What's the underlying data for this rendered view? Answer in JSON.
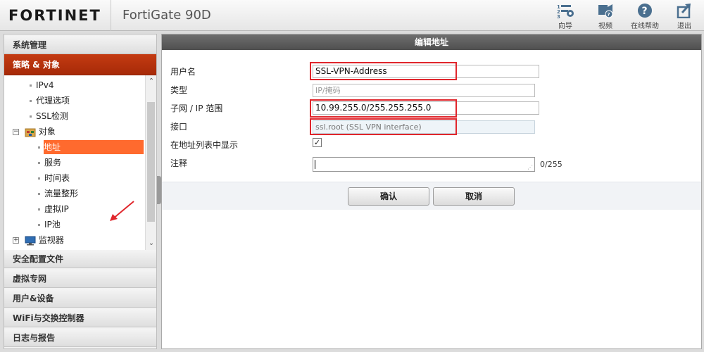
{
  "header": {
    "logo": "FORTINET",
    "product": "FortiGate 90D",
    "tools": [
      {
        "label": "向导",
        "icon": "wizard-icon"
      },
      {
        "label": "视频",
        "icon": "video-icon"
      },
      {
        "label": "在线帮助",
        "icon": "help-icon"
      },
      {
        "label": "退出",
        "icon": "logout-icon"
      }
    ]
  },
  "sidebar": {
    "sections_top": [
      {
        "label": "系统管理"
      },
      {
        "label": "策略 & 对象",
        "active": true
      }
    ],
    "tree": [
      {
        "label": "IPv4"
      },
      {
        "label": "代理选项"
      },
      {
        "label": "SSL检测"
      },
      {
        "label": "对象",
        "group": true,
        "icon": "folder-icon"
      },
      {
        "label": "地址",
        "selected": true
      },
      {
        "label": "服务"
      },
      {
        "label": "时间表"
      },
      {
        "label": "流量整形"
      },
      {
        "label": "虚拟IP"
      },
      {
        "label": "IP池"
      },
      {
        "label": "监视器",
        "group": true,
        "icon": "monitor-icon"
      }
    ],
    "sections_bottom": [
      {
        "label": "安全配置文件"
      },
      {
        "label": "虚拟专网"
      },
      {
        "label": "用户&设备"
      },
      {
        "label": "WiFi与交换控制器"
      },
      {
        "label": "日志与报告"
      }
    ]
  },
  "form": {
    "title": "编辑地址",
    "name_label": "用户名",
    "name_value": "SSL-VPN-Address",
    "type_label": "类型",
    "type_placeholder": "IP/掩码",
    "subnet_label": "子网 / IP 范围",
    "subnet_value": "10.99.255.0/255.255.255.0",
    "interface_label": "接口",
    "interface_value": "ssl.root (SSL VPN interface)",
    "show_in_list_label": "在地址列表中显示",
    "show_in_list_checked": true,
    "comment_label": "注释",
    "comment_value": "",
    "comment_counter": "0/255",
    "ok_label": "确认",
    "cancel_label": "取消"
  },
  "colors": {
    "brand_red": "#c43b12",
    "selected_orange": "#ff6a2e",
    "highlight_red": "#e0262c"
  }
}
